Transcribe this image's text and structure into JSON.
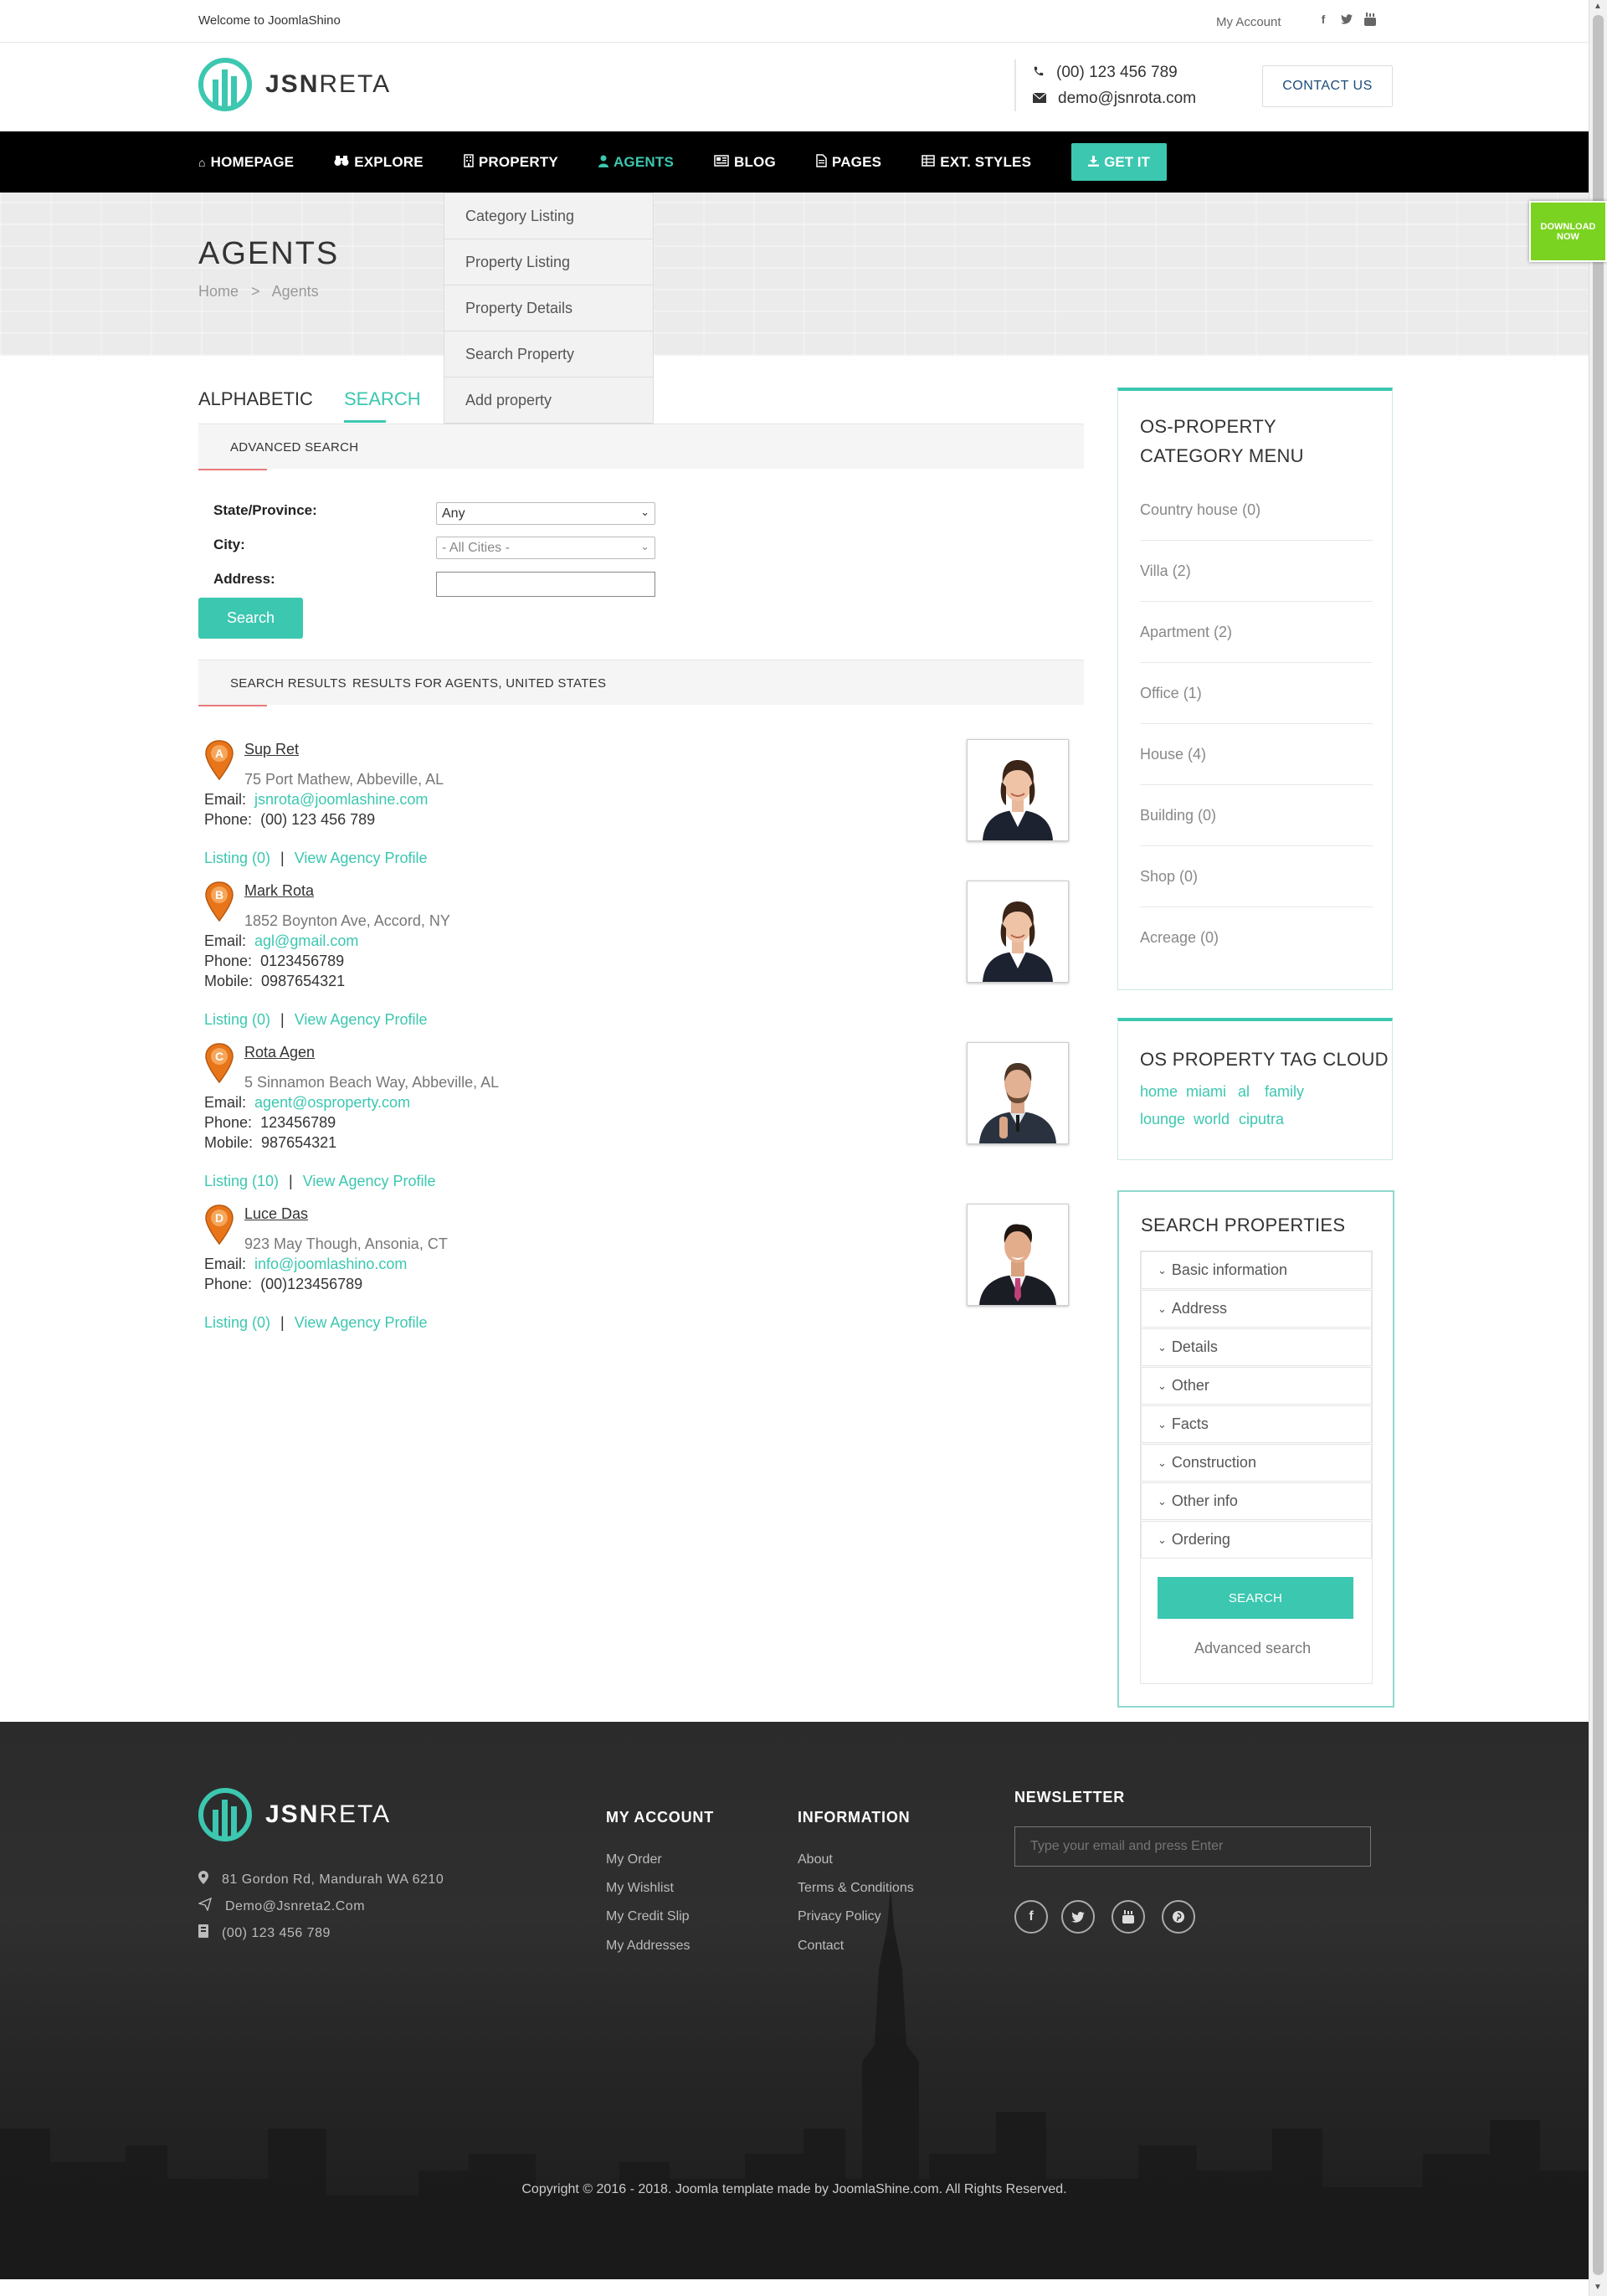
{
  "topbar": {
    "welcome": "Welcome to JoomlaShino",
    "my_account": "My Account",
    "social_icons": [
      "facebook-icon",
      "twitter-icon",
      "youtube-icon"
    ]
  },
  "header": {
    "logo_bold": "JSN",
    "logo_light": "RETA",
    "phone": "(00) 123 456 789",
    "email": "demo@jsnrota.com",
    "contact_button": "CONTACT US"
  },
  "nav": {
    "items": [
      {
        "label": "HOMEPAGE",
        "icon": "home-icon"
      },
      {
        "label": "EXPLORE",
        "icon": "binoculars-icon"
      },
      {
        "label": "PROPERTY",
        "icon": "building-icon"
      },
      {
        "label": "AGENTS",
        "icon": "user-icon"
      },
      {
        "label": "BLOG",
        "icon": "newspaper-icon"
      },
      {
        "label": "PAGES",
        "icon": "file-icon"
      },
      {
        "label": "EXT. STYLES",
        "icon": "grid-icon"
      }
    ],
    "cta": "GET IT",
    "accent": "#3cc7b0"
  },
  "dropdown": {
    "items": [
      "Category Listing",
      "Property Listing",
      "Property Details",
      "Search Property",
      "Add property"
    ]
  },
  "download_badge": "DOWNLOAD NOW",
  "banner": {
    "title": "AGENTS",
    "breadcrumb_home": "Home",
    "breadcrumb_sep": ">",
    "breadcrumb_current": "Agents"
  },
  "tabs": {
    "alphabetic": "ALPHABETIC",
    "search": "SEARCH"
  },
  "advanced_search": {
    "title": "ADVANCED SEARCH",
    "state_label": "State/Province:",
    "state_value": "Any",
    "city_label": "City:",
    "city_value": "- All Cities -",
    "address_label": "Address:",
    "address_value": "",
    "button": "Search"
  },
  "results_bar": {
    "title": "SEARCH RESULTS",
    "subtitle": "RESULTS FOR AGENTS, UNITED STATES"
  },
  "agents": [
    {
      "letter": "A",
      "name": "Sup Ret",
      "address": "75 Port Mathew, Abbeville, AL",
      "email_label": "Email:",
      "email": "jsnrota@joomlashine.com",
      "phone_label": "Phone:",
      "phone": "(00) 123 456 789",
      "mobile_label": "",
      "mobile": "",
      "listing": "Listing (0)",
      "profile": "View Agency Profile"
    },
    {
      "letter": "B",
      "name": "Mark Rota",
      "address": "1852 Boynton Ave, Accord, NY",
      "email_label": "Email:",
      "email": "agl@gmail.com",
      "phone_label": "Phone:",
      "phone": "0123456789",
      "mobile_label": "Mobile:",
      "mobile": "0987654321",
      "listing": "Listing (0)",
      "profile": "View Agency Profile"
    },
    {
      "letter": "C",
      "name": "Rota Agen",
      "address": "5 Sinnamon Beach Way, Abbeville, AL",
      "email_label": "Email:",
      "email": "agent@osproperty.com",
      "phone_label": "Phone:",
      "phone": "123456789",
      "mobile_label": "Mobile:",
      "mobile": "987654321",
      "listing": "Listing (10)",
      "profile": "View Agency Profile"
    },
    {
      "letter": "D",
      "name": "Luce Das",
      "address": "923 May Though, Ansonia, CT",
      "email_label": "Email:",
      "email": "info@joomlashino.com",
      "phone_label": "Phone:",
      "phone": "(00)123456789",
      "mobile_label": "",
      "mobile": "",
      "listing": "Listing (0)",
      "profile": "View Agency Profile"
    }
  ],
  "sidebar": {
    "category_title": "OS-PROPERTY CATEGORY MENU",
    "categories": [
      "Country house (0)",
      "Villa (2)",
      "Apartment (2)",
      "Office (1)",
      "House (4)",
      "Building (0)",
      "Shop (0)",
      "Acreage (0)"
    ],
    "tag_title": "OS PROPERTY TAG CLOUD",
    "tags": [
      "home",
      "miami",
      "al",
      "family",
      "lounge",
      "world",
      "ciputra"
    ],
    "search_title": "SEARCH PROPERTIES",
    "search_sections": [
      "Basic information",
      "Address",
      "Details",
      "Other",
      "Facts",
      "Construction",
      "Other info",
      "Ordering"
    ],
    "search_button": "SEARCH",
    "advanced_link": "Advanced search"
  },
  "footer": {
    "logo_bold": "JSN",
    "logo_light": "RETA",
    "address": "81 Gordon Rd, Mandurah WA 6210",
    "email": "Demo@Jsnreta2.Com",
    "phone": "(00) 123 456 789",
    "my_account_title": "MY ACCOUNT",
    "my_account_links": [
      "My Order",
      "My Wishlist",
      "My Credit Slip",
      "My Addresses"
    ],
    "information_title": "INFORMATION",
    "information_links": [
      "About",
      "Terms & Conditions",
      "Privacy Policy",
      "Contact"
    ],
    "newsletter_title": "NEWSLETTER",
    "newsletter_placeholder": "Type your email and press Enter",
    "social_icons": [
      "facebook-icon",
      "twitter-icon",
      "youtube-icon",
      "pinterest-icon"
    ],
    "copyright": "Copyright © 2016 - 2018. Joomla template made by JoomlaShine.com. All Rights Reserved."
  }
}
